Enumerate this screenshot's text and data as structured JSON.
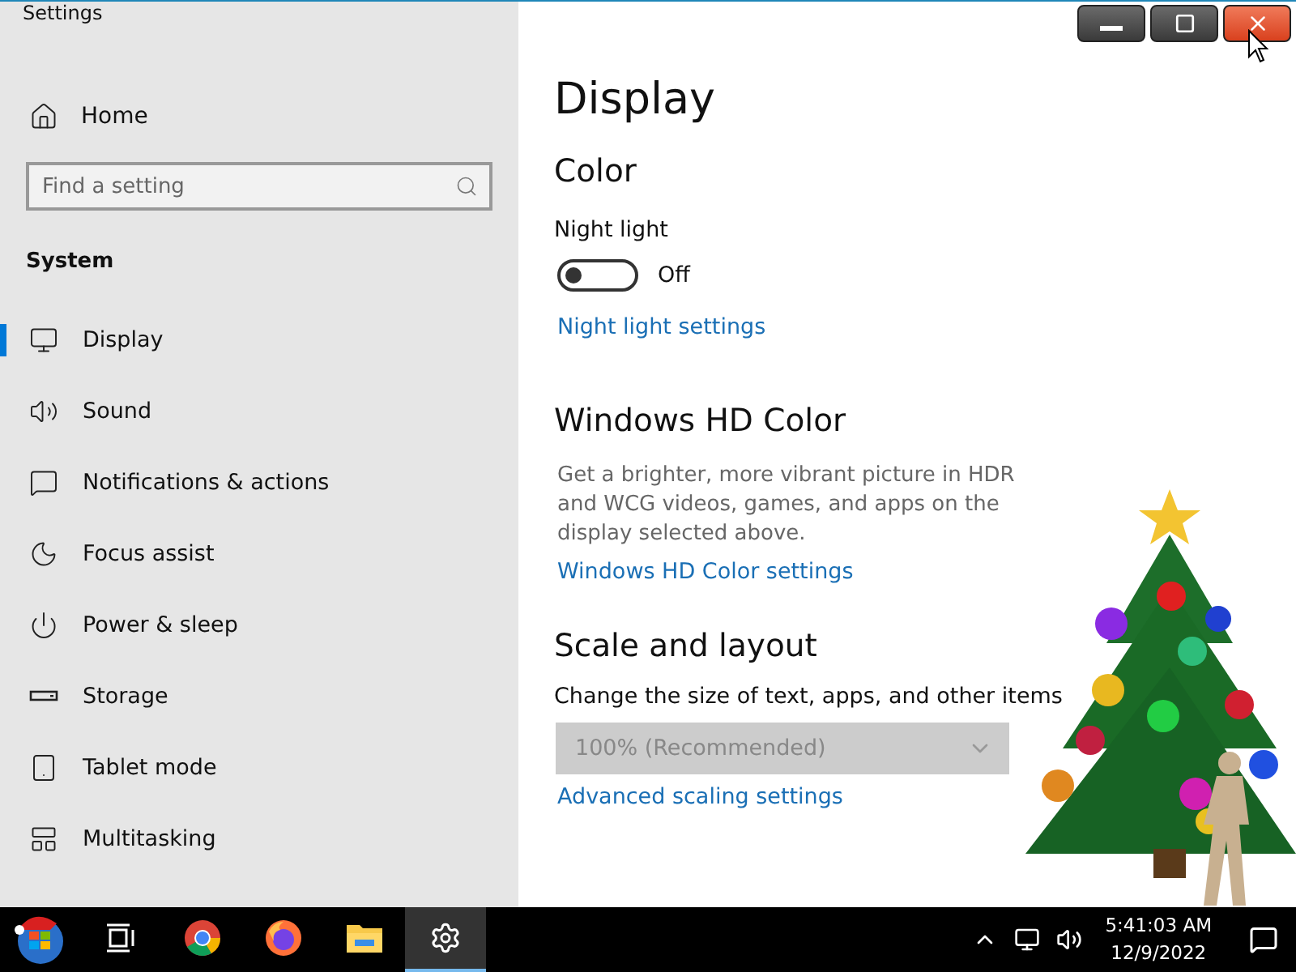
{
  "window": {
    "title": "Settings"
  },
  "sidebar": {
    "home": "Home",
    "search": {
      "placeholder": "Find a setting"
    },
    "section": "System",
    "items": [
      {
        "kind": "display",
        "label": "Display",
        "selected": true
      },
      {
        "kind": "sound",
        "label": "Sound",
        "selected": false
      },
      {
        "kind": "notifications",
        "label": "Notifications & actions",
        "selected": false
      },
      {
        "kind": "focus",
        "label": "Focus assist",
        "selected": false
      },
      {
        "kind": "power",
        "label": "Power & sleep",
        "selected": false
      },
      {
        "kind": "storage",
        "label": "Storage",
        "selected": false
      },
      {
        "kind": "tablet",
        "label": "Tablet mode",
        "selected": false
      },
      {
        "kind": "multitasking",
        "label": "Multitasking",
        "selected": false
      }
    ]
  },
  "content": {
    "title": "Display",
    "color_section": {
      "heading": "Color",
      "night_light": {
        "label": "Night light",
        "on": false,
        "state_text": "Off"
      },
      "link": "Night light settings"
    },
    "hd_color_section": {
      "heading": "Windows HD Color",
      "description": "Get a brighter, more vibrant picture in HDR and WCG videos, games, and apps on the display selected above.",
      "link": "Windows HD Color settings"
    },
    "scale_section": {
      "heading": "Scale and layout",
      "label": "Change the size of text, apps, and other items",
      "dropdown": {
        "value": "100% (Recommended)",
        "disabled": true
      },
      "link": "Advanced scaling settings"
    }
  },
  "taskbar": {
    "apps": [
      {
        "kind": "taskview",
        "selected": false
      },
      {
        "kind": "chrome",
        "selected": false
      },
      {
        "kind": "firefox",
        "selected": false
      },
      {
        "kind": "explorer",
        "selected": false
      },
      {
        "kind": "settings",
        "selected": true
      }
    ],
    "time": "5:41:03 AM",
    "date": "12/9/2022"
  }
}
